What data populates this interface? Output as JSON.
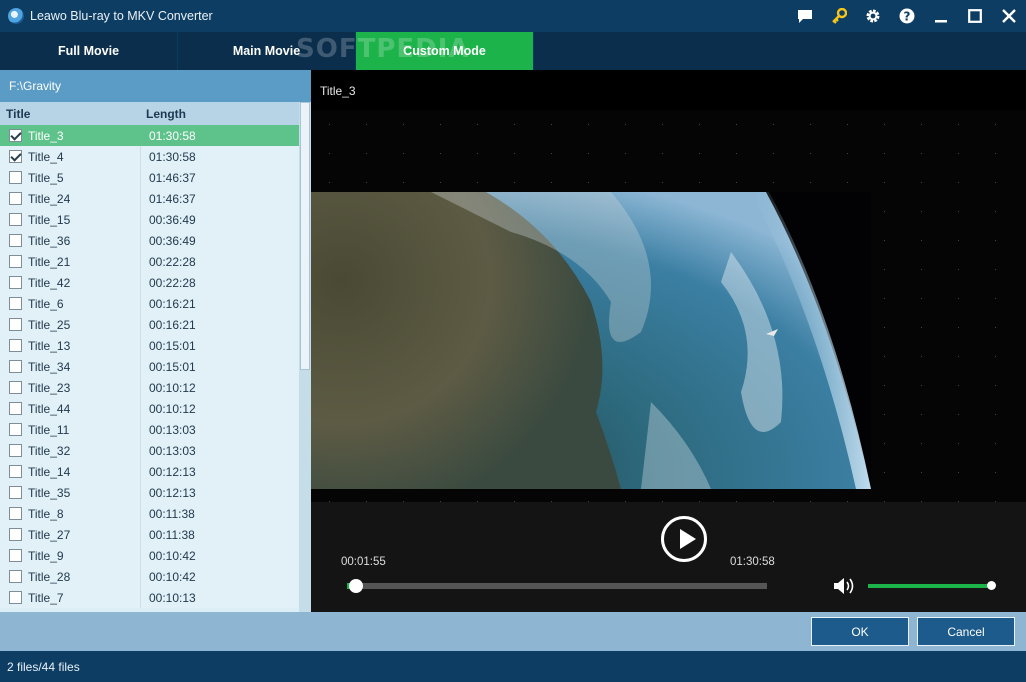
{
  "window": {
    "title": "Leawo Blu-ray to MKV Converter",
    "icons": [
      "chat-icon",
      "key-icon",
      "gear-icon",
      "help-icon",
      "minimize-icon",
      "maximize-icon",
      "close-icon"
    ]
  },
  "tabs": [
    {
      "label": "Full Movie",
      "active": false
    },
    {
      "label": "Main Movie",
      "active": false
    },
    {
      "label": "Custom Mode",
      "active": true
    }
  ],
  "watermark": "SOFTPEDIA",
  "left_panel": {
    "path": "F:\\Gravity",
    "columns": {
      "title": "Title",
      "length": "Length"
    },
    "rows": [
      {
        "title": "Title_3",
        "length": "01:30:58",
        "checked": true,
        "selected": true
      },
      {
        "title": "Title_4",
        "length": "01:30:58",
        "checked": true,
        "selected": false
      },
      {
        "title": "Title_5",
        "length": "01:46:37",
        "checked": false,
        "selected": false
      },
      {
        "title": "Title_24",
        "length": "01:46:37",
        "checked": false,
        "selected": false
      },
      {
        "title": "Title_15",
        "length": "00:36:49",
        "checked": false,
        "selected": false
      },
      {
        "title": "Title_36",
        "length": "00:36:49",
        "checked": false,
        "selected": false
      },
      {
        "title": "Title_21",
        "length": "00:22:28",
        "checked": false,
        "selected": false
      },
      {
        "title": "Title_42",
        "length": "00:22:28",
        "checked": false,
        "selected": false
      },
      {
        "title": "Title_6",
        "length": "00:16:21",
        "checked": false,
        "selected": false
      },
      {
        "title": "Title_25",
        "length": "00:16:21",
        "checked": false,
        "selected": false
      },
      {
        "title": "Title_13",
        "length": "00:15:01",
        "checked": false,
        "selected": false
      },
      {
        "title": "Title_34",
        "length": "00:15:01",
        "checked": false,
        "selected": false
      },
      {
        "title": "Title_23",
        "length": "00:10:12",
        "checked": false,
        "selected": false
      },
      {
        "title": "Title_44",
        "length": "00:10:12",
        "checked": false,
        "selected": false
      },
      {
        "title": "Title_11",
        "length": "00:13:03",
        "checked": false,
        "selected": false
      },
      {
        "title": "Title_32",
        "length": "00:13:03",
        "checked": false,
        "selected": false
      },
      {
        "title": "Title_14",
        "length": "00:12:13",
        "checked": false,
        "selected": false
      },
      {
        "title": "Title_35",
        "length": "00:12:13",
        "checked": false,
        "selected": false
      },
      {
        "title": "Title_8",
        "length": "00:11:38",
        "checked": false,
        "selected": false
      },
      {
        "title": "Title_27",
        "length": "00:11:38",
        "checked": false,
        "selected": false
      },
      {
        "title": "Title_9",
        "length": "00:10:42",
        "checked": false,
        "selected": false
      },
      {
        "title": "Title_28",
        "length": "00:10:42",
        "checked": false,
        "selected": false
      },
      {
        "title": "Title_7",
        "length": "00:10:13",
        "checked": false,
        "selected": false
      }
    ]
  },
  "player": {
    "title": "Title_3",
    "current_time": "00:01:55",
    "total_time": "01:30:58",
    "progress": 0.021,
    "volume": 1.0
  },
  "buttons": {
    "ok": "OK",
    "cancel": "Cancel"
  },
  "status": "2 files/44 files",
  "colors": {
    "accent": "#1bb34a",
    "titlebar": "#0d3d63",
    "button": "#1c5b8b",
    "selected_row": "#5ec38b"
  }
}
